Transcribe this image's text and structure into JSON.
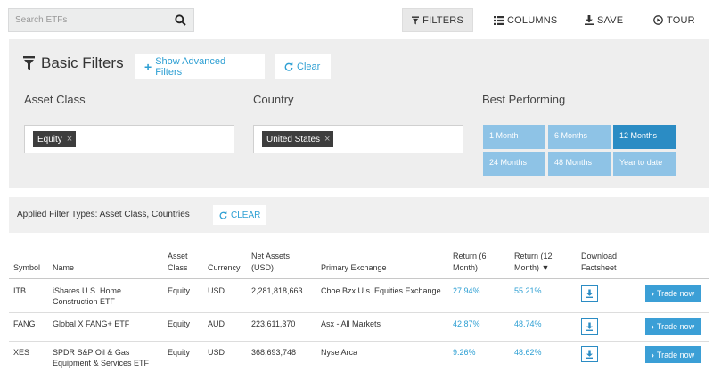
{
  "search": {
    "placeholder": "Search ETFs",
    "icon": "search-icon"
  },
  "toolbar": {
    "filters": "FILTERS",
    "columns": "COLUMNS",
    "save": "SAVE",
    "tour": "TOUR"
  },
  "panel": {
    "title": "Basic Filters",
    "show_advanced": "Show Advanced Filters",
    "clear": "Clear",
    "asset_class": {
      "label": "Asset Class",
      "tag": "Equity"
    },
    "country": {
      "label": "Country",
      "tag": "United States"
    },
    "best_performing": {
      "label": "Best Performing",
      "options": [
        "1 Month",
        "6 Months",
        "12 Months",
        "24 Months",
        "48 Months",
        "Year to date"
      ],
      "selected": "12 Months"
    }
  },
  "applied": {
    "text": "Applied Filter Types: Asset Class, Countries",
    "clear": "CLEAR"
  },
  "table": {
    "headers": {
      "symbol": "Symbol",
      "name": "Name",
      "asset_class_1": "Asset",
      "asset_class_2": "Class",
      "currency": "Currency",
      "net_assets_1": "Net Assets",
      "net_assets_2": "(USD)",
      "exchange": "Primary Exchange",
      "ret6_1": "Return (6",
      "ret6_2": "Month)",
      "ret12_1": "Return (12",
      "ret12_2": "Month) ▼",
      "download_1": "Download",
      "download_2": "Factsheet"
    },
    "rows": [
      {
        "symbol": "ITB",
        "name1": "iShares U.S. Home",
        "name2": "Construction ETF",
        "asset_class": "Equity",
        "currency": "USD",
        "net_assets": "2,281,818,663",
        "exchange": "Cboe Bzx U.s. Equities Exchange",
        "ret6": "27.94%",
        "ret12": "55.21%",
        "trade": "Trade now"
      },
      {
        "symbol": "FANG",
        "name1": "Global X FANG+ ETF",
        "name2": "",
        "asset_class": "Equity",
        "currency": "AUD",
        "net_assets": "223,611,370",
        "exchange": "Asx - All Markets",
        "ret6": "42.87%",
        "ret12": "48.74%",
        "trade": "Trade now"
      },
      {
        "symbol": "XES",
        "name1": "SPDR S&P Oil & Gas",
        "name2": "Equipment & Services ETF",
        "asset_class": "Equity",
        "currency": "USD",
        "net_assets": "368,693,748",
        "exchange": "Nyse Arca",
        "ret6": "9.26%",
        "ret12": "48.62%",
        "trade": "Trade now"
      }
    ]
  },
  "colors": {
    "accent": "#2d9fd3",
    "selected_period": "#2b8cc4",
    "period_button": "#8ec3e6",
    "panel_bg": "#eeeeee"
  }
}
